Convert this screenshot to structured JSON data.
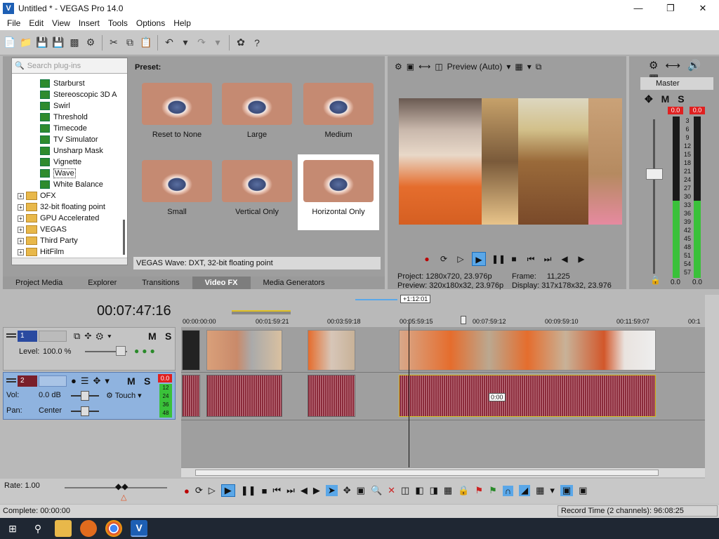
{
  "window": {
    "title": "Untitled * - VEGAS Pro 14.0"
  },
  "menu": [
    "File",
    "Edit",
    "View",
    "Insert",
    "Tools",
    "Options",
    "Help"
  ],
  "fx_browser": {
    "search_placeholder": "Search plug-ins",
    "plugins": [
      "Starburst",
      "Stereoscopic 3D A",
      "Swirl",
      "Threshold",
      "Timecode",
      "TV Simulator",
      "Unsharp Mask",
      "Vignette",
      "Wave",
      "White Balance"
    ],
    "selected_plugin": "Wave",
    "folders": [
      "OFX",
      "32-bit floating point",
      "GPU Accelerated",
      "VEGAS",
      "Third Party",
      "HitFilm"
    ]
  },
  "presets": {
    "heading": "Preset:",
    "items": [
      "Reset to None",
      "Large",
      "Medium",
      "Small",
      "Vertical Only",
      "Horizontal Only"
    ],
    "selected": "Horizontal Only",
    "status": "VEGAS Wave: DXT, 32-bit floating point"
  },
  "tabs": [
    "Project Media",
    "Explorer",
    "Transitions",
    "Video FX",
    "Media Generators"
  ],
  "active_tab": "Video FX",
  "preview": {
    "mode": "Preview (Auto)",
    "project_label": "Project:",
    "project_value": "1280x720, 23.976p",
    "preview_label": "Preview:",
    "preview_value": "320x180x32, 23.976p",
    "frame_label": "Frame:",
    "frame_value": "11,225",
    "display_label": "Display:",
    "display_value": "317x178x32, 23.976"
  },
  "master": {
    "label": "Master",
    "m": "M",
    "s": "S",
    "peak_left": "0.0",
    "peak_right": "0.0",
    "level_left": "0.0",
    "level_right": "0.0",
    "scale": [
      "3",
      "6",
      "9",
      "12",
      "15",
      "18",
      "21",
      "24",
      "27",
      "30",
      "33",
      "36",
      "39",
      "42",
      "45",
      "48",
      "51",
      "54",
      "57"
    ]
  },
  "timeline": {
    "timecode": "00:07:47:16",
    "loop_badge": "+1:12:01",
    "ruler": [
      "00:00:00:00",
      "00:01:59:21",
      "00:03:59:18",
      "00:05:59:15",
      "00:07:59:12",
      "00:09:59:10",
      "00:11:59:07",
      "00:1"
    ],
    "track1": {
      "num": "1",
      "level_label": "Level:",
      "level_value": "100.0 %",
      "m": "M",
      "s": "S"
    },
    "track2": {
      "num": "2",
      "vol_label": "Vol:",
      "vol_value": "0.0 dB",
      "pan_label": "Pan:",
      "pan_value": "Center",
      "touch": "Touch",
      "m": "M",
      "s": "S",
      "peak": "0.0",
      "meter": [
        "12",
        "24",
        "36",
        "48"
      ]
    },
    "fade_tooltip": "0:00"
  },
  "footer": {
    "rate": "Rate: 1.00",
    "complete": "Complete: 00:00:00",
    "record_time": "Record Time (2 channels): 96:08:25"
  },
  "colors": {
    "accent": "#5aa7e8",
    "meter_green": "#3ac13a",
    "peak_red": "#e02020",
    "audio": "#8a2a3a"
  }
}
